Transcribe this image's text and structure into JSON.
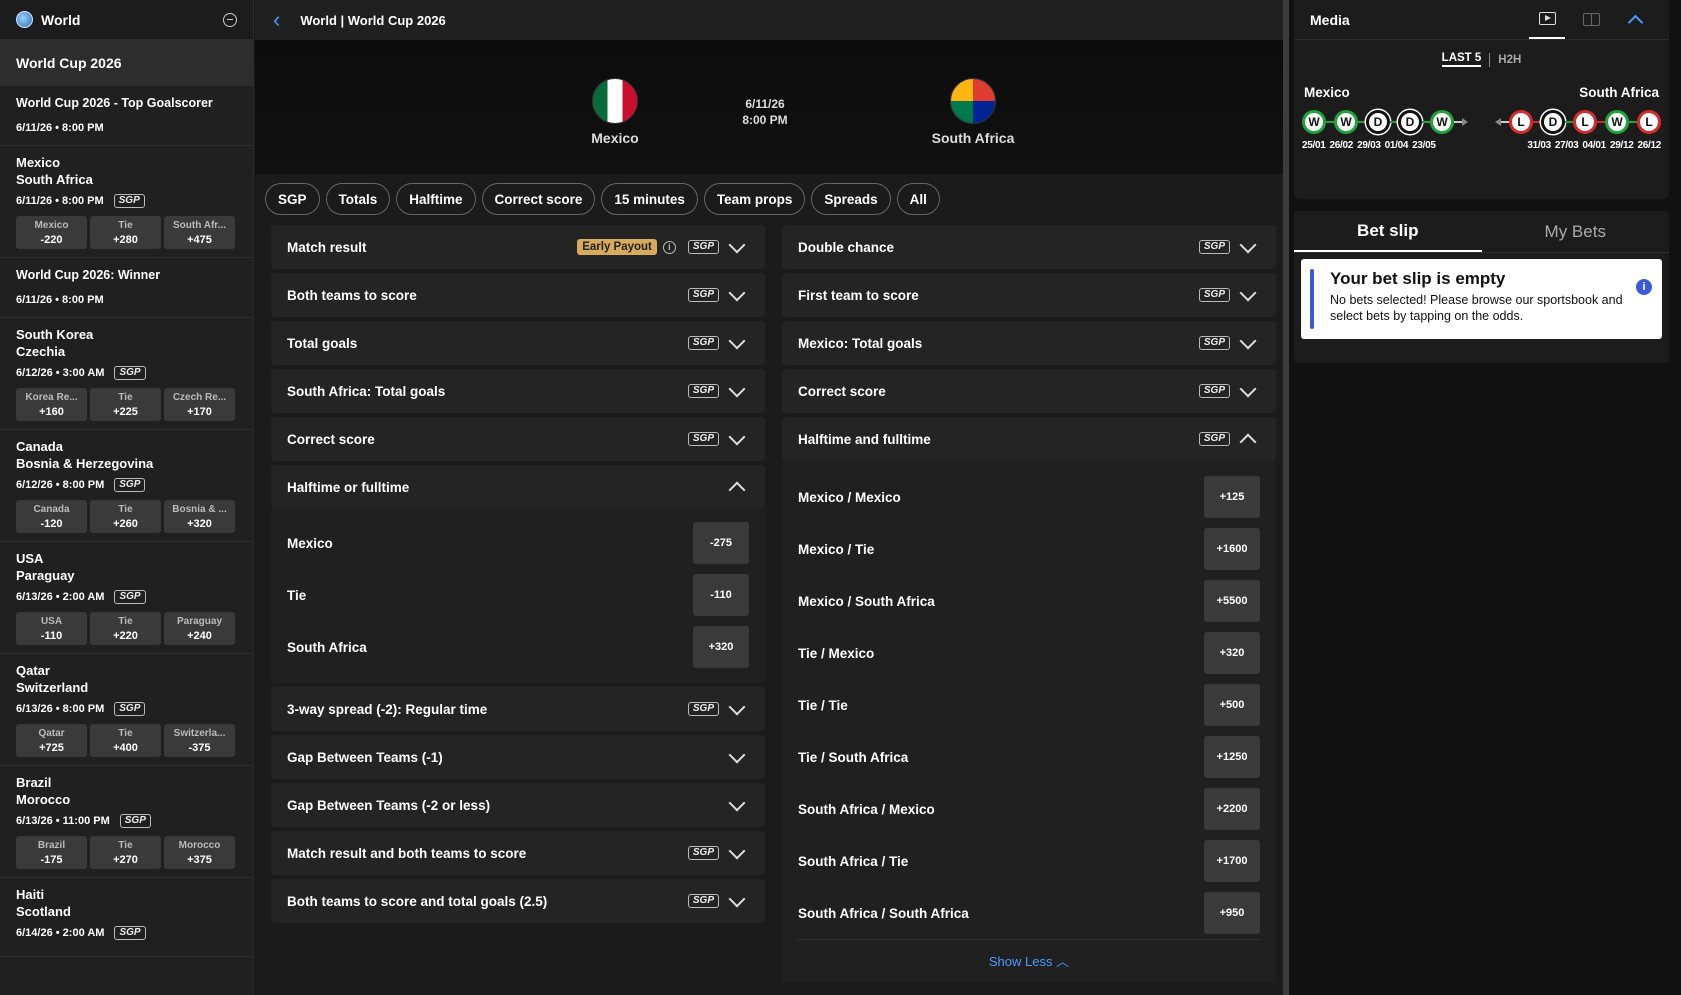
{
  "sidebar": {
    "header": "World",
    "banner": "World Cup 2026",
    "outrights": [
      {
        "title": "World Cup 2026 - Top Goalscorer",
        "time": "6/11/26 • 8:00 PM"
      },
      {
        "title": "World Cup 2026: Winner",
        "time": "6/11/26 • 8:00 PM"
      }
    ],
    "games": [
      {
        "home": "Mexico",
        "away": "South Africa",
        "time": "6/11/26 • 8:00 PM",
        "sgp": "SGP",
        "odds": [
          {
            "n": "Mexico",
            "v": "-220"
          },
          {
            "n": "Tie",
            "v": "+280"
          },
          {
            "n": "South Afr...",
            "v": "+475"
          }
        ]
      },
      {
        "home": "South Korea",
        "away": "Czechia",
        "time": "6/12/26 • 3:00 AM",
        "sgp": "SGP",
        "odds": [
          {
            "n": "Korea Re...",
            "v": "+160"
          },
          {
            "n": "Tie",
            "v": "+225"
          },
          {
            "n": "Czech Re...",
            "v": "+170"
          }
        ]
      },
      {
        "home": "Canada",
        "away": "Bosnia & Herzegovina",
        "time": "6/12/26 • 8:00 PM",
        "sgp": "SGP",
        "odds": [
          {
            "n": "Canada",
            "v": "-120"
          },
          {
            "n": "Tie",
            "v": "+260"
          },
          {
            "n": "Bosnia & ...",
            "v": "+320"
          }
        ]
      },
      {
        "home": "USA",
        "away": "Paraguay",
        "time": "6/13/26 • 2:00 AM",
        "sgp": "SGP",
        "odds": [
          {
            "n": "USA",
            "v": "-110"
          },
          {
            "n": "Tie",
            "v": "+220"
          },
          {
            "n": "Paraguay",
            "v": "+240"
          }
        ]
      },
      {
        "home": "Qatar",
        "away": "Switzerland",
        "time": "6/13/26 • 8:00 PM",
        "sgp": "SGP",
        "odds": [
          {
            "n": "Qatar",
            "v": "+725"
          },
          {
            "n": "Tie",
            "v": "+400"
          },
          {
            "n": "Switzerla...",
            "v": "-375"
          }
        ]
      },
      {
        "home": "Brazil",
        "away": "Morocco",
        "time": "6/13/26 • 11:00 PM",
        "sgp": "SGP",
        "odds": [
          {
            "n": "Brazil",
            "v": "-175"
          },
          {
            "n": "Tie",
            "v": "+270"
          },
          {
            "n": "Morocco",
            "v": "+375"
          }
        ]
      },
      {
        "home": "Haiti",
        "away": "Scotland",
        "time": "6/14/26 • 2:00 AM",
        "sgp": "SGP",
        "odds": []
      }
    ]
  },
  "main": {
    "breadcrumb": "World | World Cup 2026",
    "home": "Mexico",
    "away": "South Africa",
    "date": "6/11/26",
    "time": "8:00 PM",
    "tabs": [
      "SGP",
      "Totals",
      "Halftime",
      "Correct score",
      "15 minutes",
      "Team props",
      "Spreads",
      "All"
    ],
    "early_payout": "Early Payout",
    "left_markets_a": [
      {
        "label": "Match result",
        "sgp": "SGP"
      },
      {
        "label": "Both teams to score",
        "sgp": "SGP"
      },
      {
        "label": "Total goals",
        "sgp": "SGP"
      },
      {
        "label": "South Africa: Total goals",
        "sgp": "SGP"
      },
      {
        "label": "Correct score",
        "sgp": "SGP"
      }
    ],
    "htft": {
      "label": "Halftime or fulltime",
      "options": [
        {
          "n": "Mexico",
          "v": "-275"
        },
        {
          "n": "Tie",
          "v": "-110"
        },
        {
          "n": "South Africa",
          "v": "+320"
        }
      ]
    },
    "left_markets_b": [
      {
        "label": "3-way spread (-2): Regular time",
        "sgp": "SGP"
      },
      {
        "label": "Gap Between Teams (-1)",
        "sgp": ""
      },
      {
        "label": "Gap Between Teams (-2 or less)",
        "sgp": ""
      },
      {
        "label": "Match result and both teams to score",
        "sgp": "SGP"
      },
      {
        "label": "Both teams to score and total goals (2.5)",
        "sgp": "SGP"
      }
    ],
    "right_markets": [
      {
        "label": "Double chance",
        "sgp": "SGP"
      },
      {
        "label": "First team to score",
        "sgp": "SGP"
      },
      {
        "label": "Mexico: Total goals",
        "sgp": "SGP"
      },
      {
        "label": "Correct score",
        "sgp": "SGP"
      }
    ],
    "halftime_fulltime": {
      "label": "Halftime and fulltime",
      "sgp": "SGP",
      "options": [
        {
          "n": "Mexico / Mexico",
          "v": "+125"
        },
        {
          "n": "Mexico / Tie",
          "v": "+1600"
        },
        {
          "n": "Mexico / South Africa",
          "v": "+5500"
        },
        {
          "n": "Tie / Mexico",
          "v": "+320"
        },
        {
          "n": "Tie / Tie",
          "v": "+500"
        },
        {
          "n": "Tie / South Africa",
          "v": "+1250"
        },
        {
          "n": "South Africa / Mexico",
          "v": "+2200"
        },
        {
          "n": "South Africa / Tie",
          "v": "+1700"
        },
        {
          "n": "South Africa / South Africa",
          "v": "+950"
        }
      ]
    },
    "show_less": "Show Less"
  },
  "media": {
    "title": "Media",
    "last5": "LAST 5",
    "h2h": "H2H",
    "home": "Mexico",
    "away": "South Africa",
    "home_form": [
      "W",
      "W",
      "D",
      "D",
      "W"
    ],
    "away_form": [
      "L",
      "D",
      "L",
      "W",
      "L"
    ],
    "home_dates": [
      "25/01",
      "26/02",
      "29/03",
      "01/04",
      "23/05"
    ],
    "away_dates": [
      "31/03",
      "27/03",
      "04/01",
      "29/12",
      "26/12"
    ]
  },
  "betslip": {
    "tab_slip": "Bet slip",
    "tab_mybets": "My Bets",
    "empty_title": "Your bet slip is empty",
    "empty_text": "No bets selected! Please browse our sportsbook and select bets by tapping on the odds."
  }
}
